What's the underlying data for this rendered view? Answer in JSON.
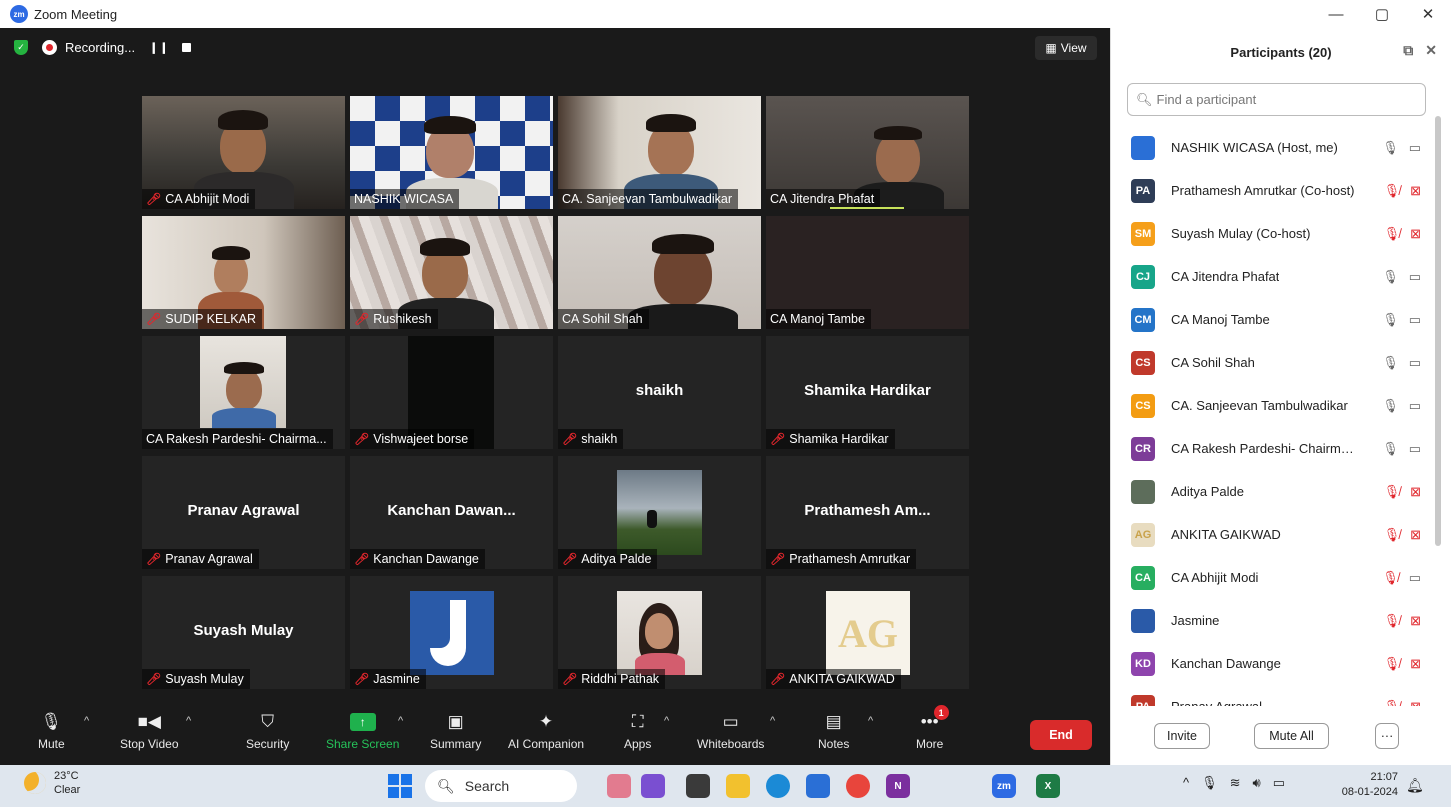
{
  "window": {
    "title": "Zoom Meeting",
    "minimize": "—",
    "restore": "▢",
    "close": "✕"
  },
  "topbar": {
    "recording_label": "Recording...",
    "pause": "❙❙",
    "view_label": "View"
  },
  "tiles": [
    {
      "name": "CA Abhijit Modi",
      "muted": true,
      "video": true,
      "big": ""
    },
    {
      "name": "NASHIK WICASA",
      "muted": false,
      "video": true,
      "big": ""
    },
    {
      "name": "CA. Sanjeevan Tambulwadikar",
      "muted": false,
      "video": true,
      "big": ""
    },
    {
      "name": "CA Jitendra Phafat",
      "muted": false,
      "video": true,
      "big": ""
    },
    {
      "name": "SUDIP KELKAR",
      "muted": true,
      "video": true,
      "big": ""
    },
    {
      "name": "Rushikesh",
      "muted": true,
      "video": true,
      "big": ""
    },
    {
      "name": "CA Sohil Shah",
      "muted": false,
      "video": true,
      "big": ""
    },
    {
      "name": "CA Manoj Tambe",
      "muted": false,
      "video": false,
      "big": ""
    },
    {
      "name": "CA Rakesh Pardeshi- Chairma...",
      "muted": false,
      "video": true,
      "big": ""
    },
    {
      "name": "Vishwajeet borse",
      "muted": true,
      "video": true,
      "big": ""
    },
    {
      "name": "shaikh",
      "muted": true,
      "video": false,
      "big": "shaikh"
    },
    {
      "name": "Shamika Hardikar",
      "muted": true,
      "video": false,
      "big": "Shamika Hardikar"
    },
    {
      "name": "Pranav Agrawal",
      "muted": true,
      "video": false,
      "big": "Pranav Agrawal"
    },
    {
      "name": "Kanchan Dawange",
      "muted": true,
      "video": false,
      "big": "Kanchan  Dawan..."
    },
    {
      "name": "Aditya Palde",
      "muted": true,
      "video": false,
      "big": ""
    },
    {
      "name": "Prathamesh Amrutkar",
      "muted": true,
      "video": false,
      "big": "Prathamesh Am..."
    },
    {
      "name": "Suyash Mulay",
      "muted": true,
      "video": false,
      "big": "Suyash Mulay"
    },
    {
      "name": "Jasmine",
      "muted": true,
      "video": false,
      "big": ""
    },
    {
      "name": "Riddhi Pathak",
      "muted": true,
      "video": false,
      "big": ""
    },
    {
      "name": "ANKITA GAIKWAD",
      "muted": true,
      "video": false,
      "big": ""
    }
  ],
  "toolbar": {
    "mute": "Mute",
    "stop_video": "Stop Video",
    "security": "Security",
    "share_screen": "Share Screen",
    "summary": "Summary",
    "ai_companion": "AI Companion",
    "apps": "Apps",
    "whiteboards": "Whiteboards",
    "notes": "Notes",
    "more": "More",
    "more_badge": "1",
    "end": "End"
  },
  "panel": {
    "title": "Participants (20)",
    "search_placeholder": "Find a participant",
    "participants": [
      {
        "initials": "",
        "name": "NASHIK WICASA (Host, me)",
        "color": "#2a6fd6",
        "mic": "on",
        "cam": "on"
      },
      {
        "initials": "PA",
        "name": "Prathamesh Amrutkar (Co-host)",
        "color": "#2e3d57",
        "mic": "off",
        "cam": "off"
      },
      {
        "initials": "SM",
        "name": "Suyash Mulay (Co-host)",
        "color": "#f59f1a",
        "mic": "off",
        "cam": "off"
      },
      {
        "initials": "CJ",
        "name": "CA Jitendra Phafat",
        "color": "#17a589",
        "mic": "on",
        "cam": "on"
      },
      {
        "initials": "CM",
        "name": "CA Manoj Tambe",
        "color": "#2474c8",
        "mic": "on",
        "cam": "on"
      },
      {
        "initials": "CS",
        "name": "CA Sohil Shah",
        "color": "#c0392b",
        "mic": "on",
        "cam": "on"
      },
      {
        "initials": "CS",
        "name": "CA. Sanjeevan Tambulwadikar",
        "color": "#f39c12",
        "mic": "on",
        "cam": "on"
      },
      {
        "initials": "CR",
        "name": "CA Rakesh Pardeshi- Chairman...",
        "color": "#7d3c98",
        "mic": "on",
        "cam": "on"
      },
      {
        "initials": "",
        "name": "Aditya Palde",
        "color": "#5d6d5b",
        "mic": "off",
        "cam": "off"
      },
      {
        "initials": "AG",
        "name": "ANKITA GAIKWAD",
        "color": "#e8dcc0",
        "mic": "off",
        "cam": "off"
      },
      {
        "initials": "CA",
        "name": "CA Abhijit Modi",
        "color": "#27ae60",
        "mic": "off",
        "cam": "on"
      },
      {
        "initials": "",
        "name": "Jasmine",
        "color": "#2a5aa8",
        "mic": "off",
        "cam": "off"
      },
      {
        "initials": "KD",
        "name": "Kanchan Dawange",
        "color": "#8e44ad",
        "mic": "off",
        "cam": "off"
      },
      {
        "initials": "PA",
        "name": "Pranav Agrawal",
        "color": "#c0392b",
        "mic": "off",
        "cam": "off"
      }
    ],
    "invite": "Invite",
    "mute_all": "Mute All",
    "more": "···"
  },
  "taskbar": {
    "temp": "23°C",
    "weather": "Clear",
    "search": "Search",
    "time": "21:07",
    "date": "08-01-2024"
  }
}
